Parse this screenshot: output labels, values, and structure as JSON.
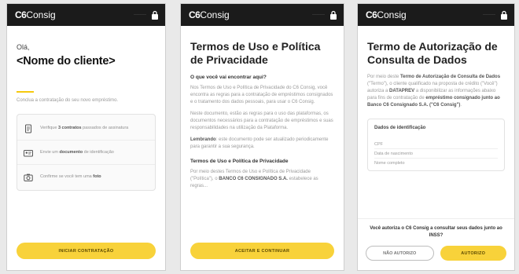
{
  "brand": {
    "logo_bold": "C6",
    "logo_text": "Consig"
  },
  "topbar": {
    "status": "········"
  },
  "colors": {
    "accent": "#f8d23a",
    "topbar": "#1b1b1b"
  },
  "screen1": {
    "greeting": "Olá,",
    "customer_name": "<Nome do cliente>",
    "intro": "Conclua a contratação do seu novo empréstimo.",
    "items": [
      {
        "icon": "document-icon",
        "text_pre": "Verifique ",
        "text_bold": "3 contratos",
        "text_post": " passados de assinatura"
      },
      {
        "icon": "id-card-icon",
        "text_pre": "Envie um ",
        "text_bold": "documento",
        "text_post": " de identificação"
      },
      {
        "icon": "camera-icon",
        "text_pre": "Confirme se você tem uma ",
        "text_bold": "foto",
        "text_post": ""
      }
    ],
    "button": "INICIAR CONTRATAÇÃO"
  },
  "screen2": {
    "title": "Termos de Uso e Política de Privacidade",
    "heading": "O que você vai encontrar aqui?",
    "para1": "Nos Termos de Uso e Política de Privacidade do C6 Consig, você encontra as regras para a contratação de empréstimos consignados e o tratamento dos dados pessoais, para usar o C6 Consig.",
    "para2": "Neste documento, estão as regras para o uso das plataformas, os documentos necessários para a contratação de empréstimos e suas responsabilidades na utilização da Plataforma.",
    "para3_bold": "Lembrando",
    "para3": ": este documento pode ser atualizado periodicamente para garantir a sua segurança.",
    "heading2": "Termos de Uso e Política de Privacidade",
    "para4_pre": "Por meio destes Termos de Uso e Política de Privacidade (\"Política\"), o ",
    "para4_bold": "BANCO C6 CONSIGNADO S.A.",
    "para4_post": " estabelece as regras...",
    "button": "ACEITAR E CONTINUAR"
  },
  "screen3": {
    "title": "Termo de Autorização de Consulta de Dados",
    "para_pre": "Por meio deste ",
    "para_b1": "Termo de Autorização de Consulta de Dados",
    "para_mid1": " (\"Termo\"), o cliente qualificado na proposta de crédito (\"Você\") autoriza a ",
    "para_b2": "DATAPREV",
    "para_mid2": " a disponibilizar as informações abaixo para fins de contratação de ",
    "para_b3": "empréstimo consignado junto ao Banco C6 Consignado S.A. (\"C6 Consig\")",
    "para_post": ".",
    "box_title": "Dados de identificação",
    "fields": [
      "CPF",
      "Data de nascimento",
      "Nome completo"
    ],
    "question": "Você autoriza o C6 Consig a consultar seus dados junto ao INSS?",
    "btn_no": "NÃO AUTORIZO",
    "btn_yes": "AUTORIZO"
  }
}
